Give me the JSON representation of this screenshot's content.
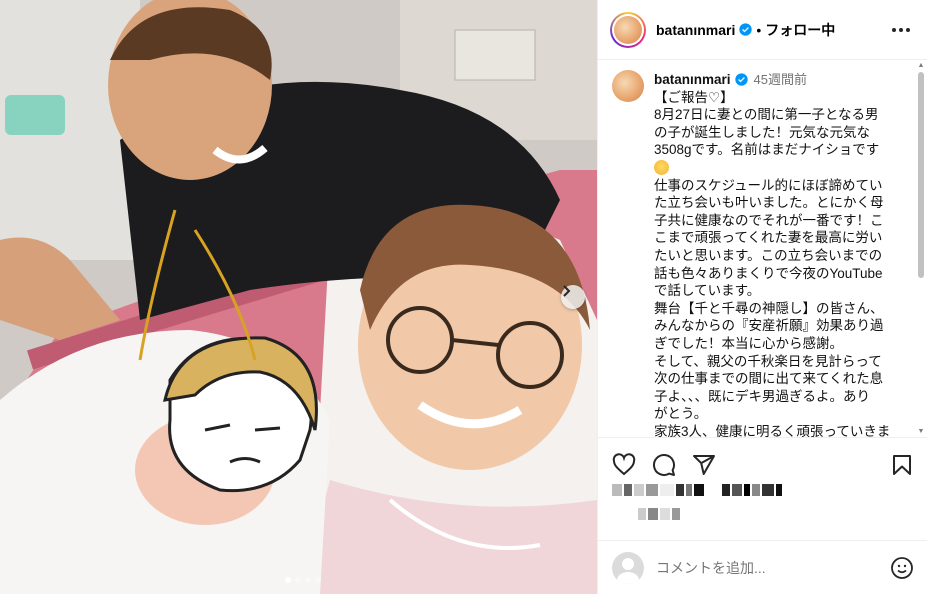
{
  "header": {
    "username": "batanınmari",
    "separator": "•",
    "follow_state": "フォロー中"
  },
  "caption": {
    "username": "batanınmari",
    "time": "45週間前",
    "lines": [
      "【ご報告♡】",
      "8月27日に妻との間に第一子となる男",
      "の子が誕生しました！元気な元気な",
      "3508gです。名前はまだナイショです",
      "仕事のスケジュール的にほぼ諦めてい",
      "た立ち会いも叶いました。とにかく母",
      "子共に健康なのでそれが一番です！こ",
      "こまで頑張ってくれた妻を最高に労い",
      "たいと思います。この立ち会いまでの",
      "話も色々ありまくりで今夜のYouTube",
      "で話しています。",
      "舞台【千と千尋の神隠し】の皆さん、",
      "みんなからの『安産祈願』効果あり過",
      "ぎでした！本当に心から感謝。",
      "そして、親父の千秋楽日を見計らって",
      "次の仕事までの間に出て来てくれた息",
      "子よ、、、既にデキ男過ぎるよ。あり",
      "がとう。",
      "家族3人、健康に明るく頑張っていきま"
    ]
  },
  "comment": {
    "placeholder": "コメントを追加..."
  },
  "icons": {
    "header_more": "more-horizontal-icon",
    "verified": "verified-badge-icon",
    "like": "heart-icon",
    "comment": "comment-bubble-icon",
    "share": "paper-plane-icon",
    "save": "bookmark-icon",
    "emoji": "smiley-icon",
    "next": "chevron-right-icon"
  },
  "colors": {
    "verified": "#0095f6",
    "border": "#efefef",
    "muted_text": "#737373"
  },
  "carousel": {
    "slide_count": 4,
    "active_index": 0
  }
}
